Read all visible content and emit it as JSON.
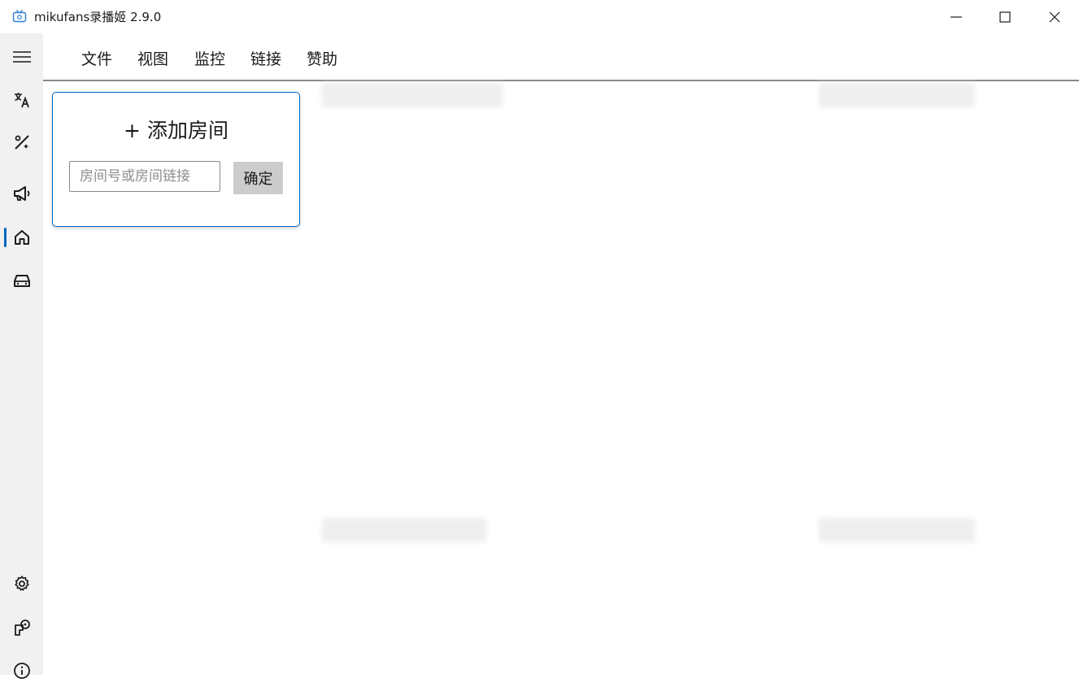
{
  "window": {
    "title": "mikufans录播姬 2.9.0",
    "icon": "tv-icon",
    "controls": [
      "minimize-icon",
      "maximize-icon",
      "close-icon"
    ]
  },
  "rail": {
    "accent_color": "#0067c0",
    "top_items": [
      "hamburger-menu-icon",
      "translate-icon",
      "toolbox-icon",
      "announcement-icon",
      "home-icon",
      "car-icon"
    ],
    "bottom_items": [
      "settings-icon",
      "feedback-icon",
      "info-icon"
    ],
    "active_item": "home-icon"
  },
  "menu": {
    "items": [
      "文件",
      "视图",
      "监控",
      "链接",
      "赞助"
    ]
  },
  "add_room": {
    "title": "+ 添加房间",
    "input_placeholder": "房间号或房间链接",
    "input_value": "",
    "confirm_label": "确定"
  }
}
